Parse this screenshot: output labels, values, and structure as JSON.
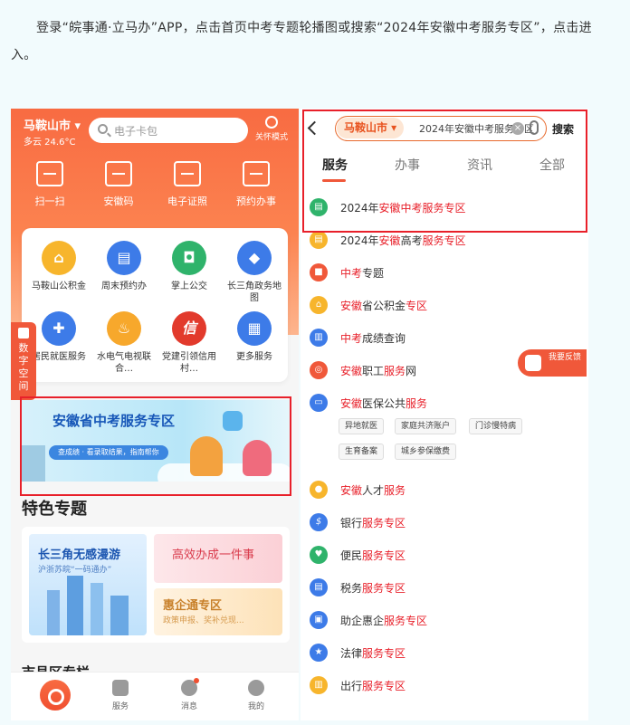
{
  "intro": "登录“皖事通·立马办”APP，点击首页中考专题轮播图或搜索“2024年安徽中考服务专区”，点击进入。",
  "left": {
    "city": "马鞍山市",
    "weather": "多云 24.6°C",
    "search_placeholder": "电子卡包",
    "care_mode": "关怀模式",
    "quick_actions": [
      "扫一扫",
      "安徽码",
      "电子证照",
      "预约办事"
    ],
    "services": [
      "马鞍山公积金",
      "周末预约办",
      "掌上公交",
      "长三角政务地图",
      "居民就医服务",
      "水电气电视联合…",
      "党建引领信用村…",
      "更多服务"
    ],
    "side_tab": "数字空间",
    "banner_title": "安徽省中考服务专区",
    "banner_sub": "查成绩 · 看录取结果，指南帮你",
    "feature_title": "特色专题",
    "feature_cards": {
      "c1_title": "长三角无感漫游",
      "c1_sub": "沪浙苏皖“一码通办”",
      "c2_title": "高效办成一件事",
      "c3_title": "惠企通专区",
      "c3_sub": "政策申报、奖补兑现..."
    },
    "region_title": "市县区专栏",
    "tabbar": [
      "服务",
      "消息",
      "我的"
    ]
  },
  "right": {
    "city_pill": "马鞍山市 ▾",
    "search_text": "2024年安徽中考服务专区",
    "search_button": "搜索",
    "tabs": [
      "服务",
      "办事",
      "资讯",
      "全部"
    ],
    "results": [
      {
        "pre": "2024年",
        "hl": "安徽中考服务专区",
        "post": ""
      },
      {
        "pre": "2024年",
        "hl": "安徽",
        "mid": "高考",
        "hl2": "服务专区",
        "post": ""
      },
      {
        "pre": "",
        "hl": "中考",
        "post": "专题"
      },
      {
        "pre": "",
        "hl": "安徽",
        "post": "省公积金",
        "hl2": "专区"
      },
      {
        "pre": "",
        "hl": "中考",
        "post": "成绩查询"
      },
      {
        "pre": "",
        "hl": "安徽",
        "post": "职工",
        "hl2": "服务",
        "post2": "网"
      },
      {
        "pre": "",
        "hl": "安徽",
        "post": "医保公共",
        "hl2": "服务"
      }
    ],
    "chips": [
      "异地就医",
      "家庭共济账户",
      "门诊慢特病",
      "生育备案",
      "城乡参保缴费"
    ],
    "results2": [
      {
        "pre": "",
        "hl": "安徽",
        "post": "人才",
        "hl2": "服务"
      },
      {
        "pre": "银行",
        "hl": "服务专区",
        "post": ""
      },
      {
        "pre": "便民",
        "hl": "服务专区",
        "post": ""
      },
      {
        "pre": "税务",
        "hl": "服务专区",
        "post": ""
      },
      {
        "pre": "助企惠企",
        "hl": "服务专区",
        "post": ""
      },
      {
        "pre": "法律",
        "hl": "服务专区",
        "post": ""
      },
      {
        "pre": "出行",
        "hl": "服务专区",
        "post": ""
      }
    ],
    "feedback": "我要反馈"
  },
  "colors": {
    "accent": "#f0583a",
    "highlight": "#e8202a"
  }
}
